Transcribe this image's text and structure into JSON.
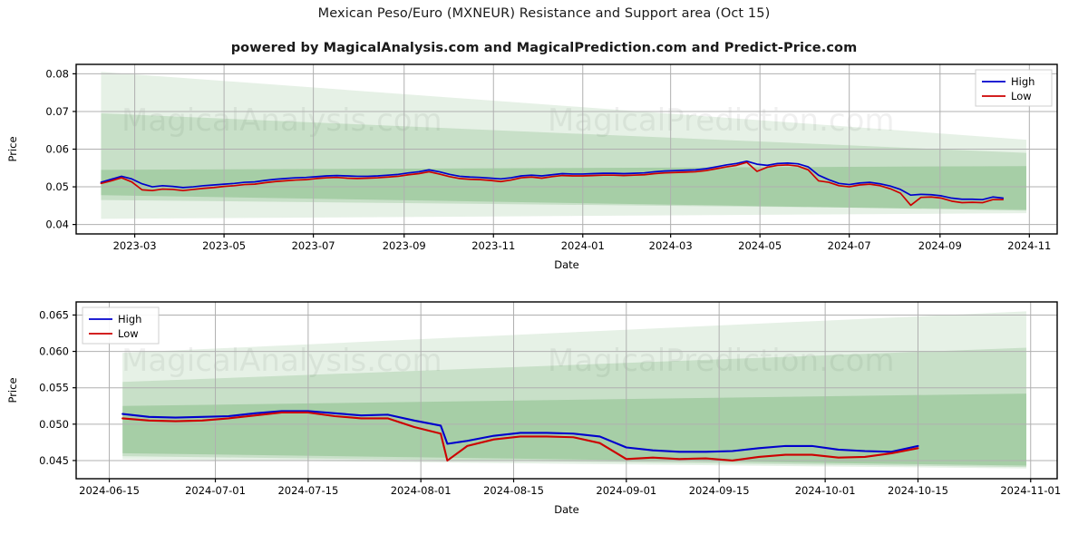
{
  "header": {
    "title": "Mexican Peso/Euro (MXNEUR) Resistance and Support area (Oct 15)",
    "subtitle": "powered by MagicalAnalysis.com and MagicalPrediction.com and Predict-Price.com"
  },
  "watermarks": {
    "left": "MagicalAnalysis.com",
    "right": "MagicalPrediction.com"
  },
  "legend": {
    "high_label": "High",
    "low_label": "Low",
    "high_color": "#0000cd",
    "low_color": "#cd0000"
  },
  "colors": {
    "high_line": "#0000cd",
    "low_line": "#cd0000",
    "band": "#2e8b2e",
    "grid": "#b0b0b0",
    "axis": "#000000",
    "background": "#ffffff"
  },
  "chart_data": [
    {
      "type": "line",
      "id": "top-chart",
      "title": "Mexican Peso/Euro (MXNEUR) Resistance and Support area (Oct 15)",
      "xlabel": "Date",
      "ylabel": "Price",
      "ylim": [
        0.0375,
        0.0825
      ],
      "yticks": [
        0.04,
        0.05,
        0.06,
        0.07,
        0.08
      ],
      "ytick_labels": [
        "0.04",
        "0.05",
        "0.06",
        "0.07",
        "0.08"
      ],
      "xticks": [
        "2023-03",
        "2023-05",
        "2023-07",
        "2023-09",
        "2023-11",
        "2024-01",
        "2024-03",
        "2024-05",
        "2024-07",
        "2024-09",
        "2024-11"
      ],
      "xlim": [
        "2023-01-20",
        "2024-11-20"
      ],
      "grid": true,
      "legend_position": "upper right",
      "x": [
        "2023-02-06",
        "2023-02-13",
        "2023-02-20",
        "2023-02-27",
        "2023-03-06",
        "2023-03-13",
        "2023-03-20",
        "2023-03-27",
        "2023-04-03",
        "2023-04-10",
        "2023-04-17",
        "2023-04-24",
        "2023-05-01",
        "2023-05-08",
        "2023-05-15",
        "2023-05-22",
        "2023-05-29",
        "2023-06-05",
        "2023-06-12",
        "2023-06-19",
        "2023-06-26",
        "2023-07-03",
        "2023-07-10",
        "2023-07-17",
        "2023-07-24",
        "2023-07-31",
        "2023-08-07",
        "2023-08-14",
        "2023-08-21",
        "2023-08-28",
        "2023-09-04",
        "2023-09-11",
        "2023-09-18",
        "2023-09-25",
        "2023-10-02",
        "2023-10-09",
        "2023-10-16",
        "2023-10-23",
        "2023-10-30",
        "2023-11-06",
        "2023-11-13",
        "2023-11-20",
        "2023-11-27",
        "2023-12-04",
        "2023-12-11",
        "2023-12-18",
        "2023-12-25",
        "2024-01-01",
        "2024-01-08",
        "2024-01-15",
        "2024-01-22",
        "2024-01-29",
        "2024-02-05",
        "2024-02-12",
        "2024-02-19",
        "2024-02-26",
        "2024-03-04",
        "2024-03-11",
        "2024-03-18",
        "2024-03-25",
        "2024-04-01",
        "2024-04-08",
        "2024-04-15",
        "2024-04-22",
        "2024-04-29",
        "2024-05-06",
        "2024-05-13",
        "2024-05-20",
        "2024-05-27",
        "2024-06-03",
        "2024-06-10",
        "2024-06-17",
        "2024-06-24",
        "2024-07-01",
        "2024-07-08",
        "2024-07-15",
        "2024-07-22",
        "2024-07-29",
        "2024-08-05",
        "2024-08-12",
        "2024-08-19",
        "2024-08-26",
        "2024-09-02",
        "2024-09-09",
        "2024-09-16",
        "2024-09-23",
        "2024-09-30",
        "2024-10-07",
        "2024-10-14"
      ],
      "series": [
        {
          "name": "High",
          "color": "#0000cd",
          "values": [
            0.0512,
            0.052,
            0.0528,
            0.0521,
            0.0508,
            0.05,
            0.0503,
            0.0501,
            0.0498,
            0.05,
            0.0503,
            0.0505,
            0.0507,
            0.0509,
            0.0512,
            0.0513,
            0.0517,
            0.052,
            0.0522,
            0.0524,
            0.0525,
            0.0527,
            0.0529,
            0.053,
            0.0529,
            0.0528,
            0.0528,
            0.0529,
            0.0531,
            0.0533,
            0.0537,
            0.054,
            0.0545,
            0.054,
            0.0533,
            0.0528,
            0.0526,
            0.0525,
            0.0523,
            0.0521,
            0.0524,
            0.0529,
            0.0531,
            0.0529,
            0.0532,
            0.0535,
            0.0534,
            0.0534,
            0.0535,
            0.0536,
            0.0536,
            0.0535,
            0.0536,
            0.0537,
            0.054,
            0.0542,
            0.0543,
            0.0544,
            0.0545,
            0.0548,
            0.0553,
            0.0558,
            0.0562,
            0.0568,
            0.056,
            0.0557,
            0.0562,
            0.0563,
            0.0561,
            0.0553,
            0.0531,
            0.0519,
            0.0509,
            0.0506,
            0.051,
            0.0512,
            0.0508,
            0.0502,
            0.0493,
            0.0478,
            0.048,
            0.0479,
            0.0476,
            0.047,
            0.0467,
            0.0467,
            0.0466,
            0.0473,
            0.047
          ]
        },
        {
          "name": "Low",
          "color": "#cd0000",
          "values": [
            0.0509,
            0.0516,
            0.0524,
            0.0513,
            0.0492,
            0.049,
            0.0494,
            0.0493,
            0.049,
            0.0493,
            0.0496,
            0.0498,
            0.0501,
            0.0503,
            0.0506,
            0.0507,
            0.0511,
            0.0514,
            0.0516,
            0.0518,
            0.0519,
            0.0522,
            0.0524,
            0.0525,
            0.0523,
            0.0522,
            0.0523,
            0.0524,
            0.0526,
            0.0528,
            0.0532,
            0.0535,
            0.054,
            0.0534,
            0.0527,
            0.0522,
            0.052,
            0.0519,
            0.0517,
            0.0514,
            0.0518,
            0.0524,
            0.0526,
            0.0523,
            0.0527,
            0.053,
            0.0529,
            0.0529,
            0.053,
            0.0531,
            0.0531,
            0.053,
            0.0531,
            0.0532,
            0.0535,
            0.0537,
            0.0538,
            0.0539,
            0.054,
            0.0543,
            0.0548,
            0.0553,
            0.0557,
            0.0565,
            0.0541,
            0.0552,
            0.0557,
            0.0558,
            0.0555,
            0.0545,
            0.0516,
            0.0512,
            0.0503,
            0.05,
            0.0505,
            0.0507,
            0.0503,
            0.0495,
            0.0483,
            0.0451,
            0.0472,
            0.0473,
            0.047,
            0.0462,
            0.0458,
            0.0459,
            0.0458,
            0.0466,
            0.0466
          ]
        }
      ],
      "bands": [
        {
          "name": "outer-resistance",
          "x0_low": 0.0415,
          "x0_high": 0.0805,
          "x1_low": 0.043,
          "x1_high": 0.0625,
          "opacity": 0.12
        },
        {
          "name": "mid-resistance",
          "x0_low": 0.0465,
          "x0_high": 0.0695,
          "x1_low": 0.044,
          "x1_high": 0.059,
          "opacity": 0.16
        },
        {
          "name": "inner-support",
          "x0_low": 0.0478,
          "x0_high": 0.0545,
          "x1_low": 0.0437,
          "x1_high": 0.0555,
          "opacity": 0.22
        }
      ]
    },
    {
      "type": "line",
      "id": "bottom-chart",
      "xlabel": "Date",
      "ylabel": "Price",
      "ylim": [
        0.0425,
        0.0668
      ],
      "yticks": [
        0.045,
        0.05,
        0.055,
        0.06,
        0.065
      ],
      "ytick_labels": [
        "0.045",
        "0.050",
        "0.055",
        "0.060",
        "0.065"
      ],
      "xticks": [
        "2024-06-15",
        "2024-07-01",
        "2024-07-15",
        "2024-08-01",
        "2024-08-15",
        "2024-09-01",
        "2024-09-15",
        "2024-10-01",
        "2024-10-15",
        "2024-11-01"
      ],
      "xlim": [
        "2024-06-10",
        "2024-11-05"
      ],
      "grid": true,
      "legend_position": "upper left",
      "x": [
        "2024-06-17",
        "2024-06-21",
        "2024-06-25",
        "2024-06-29",
        "2024-07-03",
        "2024-07-07",
        "2024-07-11",
        "2024-07-15",
        "2024-07-19",
        "2024-07-23",
        "2024-07-27",
        "2024-07-31",
        "2024-08-04",
        "2024-08-05",
        "2024-08-08",
        "2024-08-12",
        "2024-08-16",
        "2024-08-20",
        "2024-08-24",
        "2024-08-28",
        "2024-09-01",
        "2024-09-05",
        "2024-09-09",
        "2024-09-13",
        "2024-09-17",
        "2024-09-21",
        "2024-09-25",
        "2024-09-29",
        "2024-10-03",
        "2024-10-07",
        "2024-10-11",
        "2024-10-15"
      ],
      "series": [
        {
          "name": "High",
          "color": "#0000cd",
          "values": [
            0.0514,
            0.051,
            0.0509,
            0.051,
            0.0511,
            0.0515,
            0.0518,
            0.0518,
            0.0515,
            0.0512,
            0.0513,
            0.0505,
            0.0498,
            0.0473,
            0.0477,
            0.0484,
            0.0488,
            0.0488,
            0.0487,
            0.0483,
            0.0468,
            0.0464,
            0.0462,
            0.0462,
            0.0463,
            0.0467,
            0.047,
            0.047,
            0.0465,
            0.0463,
            0.0462,
            0.047
          ]
        },
        {
          "name": "Low",
          "color": "#cd0000",
          "values": [
            0.0508,
            0.0505,
            0.0504,
            0.0505,
            0.0508,
            0.0512,
            0.0516,
            0.0516,
            0.0511,
            0.0508,
            0.0508,
            0.0496,
            0.0487,
            0.045,
            0.047,
            0.0479,
            0.0483,
            0.0483,
            0.0482,
            0.0474,
            0.0452,
            0.0454,
            0.0452,
            0.0453,
            0.045,
            0.0455,
            0.0458,
            0.0458,
            0.0454,
            0.0455,
            0.046,
            0.0467
          ]
        }
      ],
      "bands": [
        {
          "name": "outer-resistance",
          "x0_low": 0.0452,
          "x0_high": 0.0598,
          "x1_low": 0.0439,
          "x1_high": 0.0655,
          "opacity": 0.12
        },
        {
          "name": "mid-resistance",
          "x0_low": 0.0456,
          "x0_high": 0.0558,
          "x1_low": 0.0441,
          "x1_high": 0.0605,
          "opacity": 0.16
        },
        {
          "name": "inner-support",
          "x0_low": 0.046,
          "x0_high": 0.0525,
          "x1_low": 0.0443,
          "x1_high": 0.0542,
          "opacity": 0.22
        }
      ]
    }
  ]
}
